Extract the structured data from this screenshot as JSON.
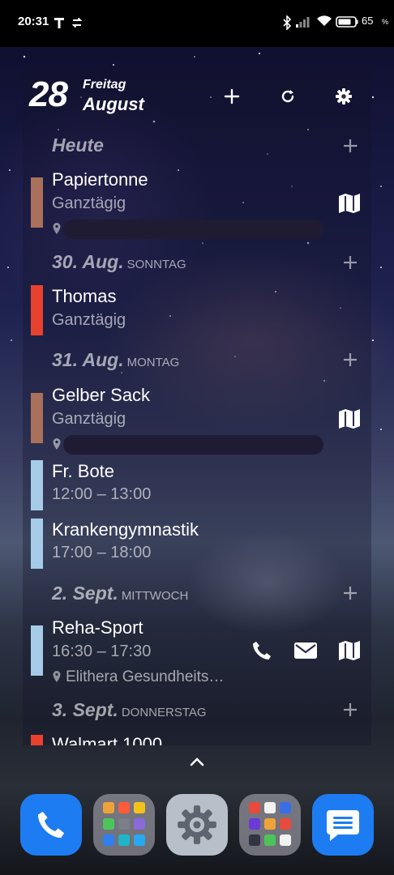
{
  "status_bar": {
    "time": "20:31",
    "battery_percent": "65"
  },
  "header": {
    "day": "28",
    "weekday": "Freitag",
    "month": "August",
    "buttons": [
      "add-icon",
      "refresh-icon",
      "gear-icon"
    ]
  },
  "days": [
    {
      "label": "Heute",
      "sub": ""
    },
    {
      "label": "30. Aug.",
      "sub": "SONNTAG"
    },
    {
      "label": "31. Aug.",
      "sub": "MONTAG"
    },
    {
      "label": "2. Sept.",
      "sub": "MITTWOCH"
    },
    {
      "label": "3. Sept.",
      "sub": "DONNERSTAG"
    }
  ],
  "events": [
    {
      "title": "Papiertonne",
      "time": "Ganztägig",
      "color": "#a9705c"
    },
    {
      "title": "Thomas",
      "time": "Ganztägig",
      "color": "#e8422f"
    },
    {
      "title": "Gelber Sack",
      "time": "Ganztägig",
      "color": "#a9705c"
    },
    {
      "title": "Fr. Bote",
      "time": "12:00 – 13:00",
      "color": "#a6cbe8"
    },
    {
      "title": "Krankengymnastik",
      "time": "17:00 – 18:00",
      "color": "#a6cbe8"
    },
    {
      "title": "Reha-Sport",
      "time": "16:30 – 17:30",
      "location": "Elithera Gesundheits…",
      "color": "#a6cbe8"
    },
    {
      "title": "Walmart 1000",
      "color": "#e8422f"
    }
  ],
  "dock": [
    "phone-app",
    "folder-apps",
    "settings-app",
    "folder-apps-2",
    "messages-app"
  ]
}
